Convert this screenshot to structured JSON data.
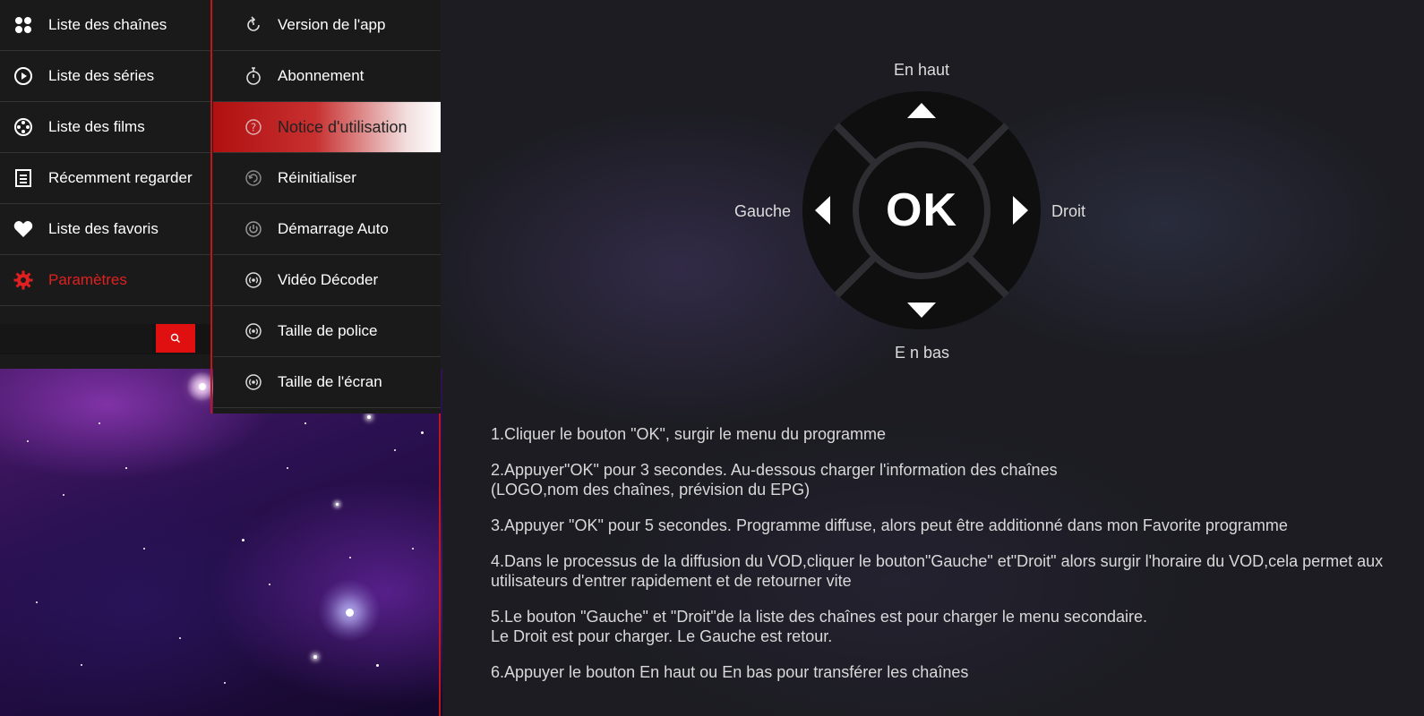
{
  "left_menu": {
    "items": [
      {
        "label": "Liste des chaînes",
        "icon": "grid-icon"
      },
      {
        "label": "Liste des séries",
        "icon": "play-circle-icon"
      },
      {
        "label": "Liste des films",
        "icon": "film-reel-icon"
      },
      {
        "label": "Récemment regarder",
        "icon": "document-list-icon"
      },
      {
        "label": "Liste des favoris",
        "icon": "heart-icon"
      },
      {
        "label": "Paramètres",
        "icon": "gear-icon",
        "active": true
      }
    ],
    "search": {
      "value": "",
      "placeholder": "",
      "icon": "search-icon"
    }
  },
  "settings_menu": {
    "items": [
      {
        "label": "Version de l'app",
        "icon": "refresh-icon"
      },
      {
        "label": "Abonnement",
        "icon": "stopwatch-icon"
      },
      {
        "label": "Notice d'utilisation",
        "icon": "question-circle-icon",
        "selected": true
      },
      {
        "label": "Réinitialiser",
        "icon": "reset-icon"
      },
      {
        "label": "Démarrage Auto",
        "icon": "power-icon"
      },
      {
        "label": "Vidéo Décoder",
        "icon": "broadcast-icon"
      },
      {
        "label": "Taille de police",
        "icon": "broadcast-icon"
      },
      {
        "label": "Taille de l'écran",
        "icon": "broadcast-icon"
      }
    ]
  },
  "remote": {
    "up": "En haut",
    "down": "E n bas",
    "left": "Gauche",
    "right": "Droit",
    "ok": "OK"
  },
  "instructions": [
    "1.Cliquer le bouton \"OK\", surgir le menu du programme",
    "2.Appuyer\"OK\" pour 3 secondes. Au-dessous charger l'information des chaînes\n(LOGO,nom des chaînes, prévision du EPG)",
    "3.Appuyer \"OK\" pour 5 secondes. Programme diffuse, alors peut être additionné dans mon Favorite programme",
    "4.Dans le processus de la diffusion du VOD,cliquer le bouton\"Gauche\" et\"Droit\" alors surgir l'horaire du VOD,cela permet aux\nutilisateurs d'entrer rapidement et de retourner vite",
    "5.Le bouton \"Gauche\" et \"Droit\"de la liste des chaînes est pour charger le menu secondaire.\nLe Droit est pour charger. Le Gauche est retour.",
    "6.Appuyer le bouton En haut ou En bas pour transférer les chaînes"
  ],
  "colors": {
    "accent": "#e01010",
    "menu_bg": "#1a1a1a",
    "page_bg": "#1c1c22"
  }
}
